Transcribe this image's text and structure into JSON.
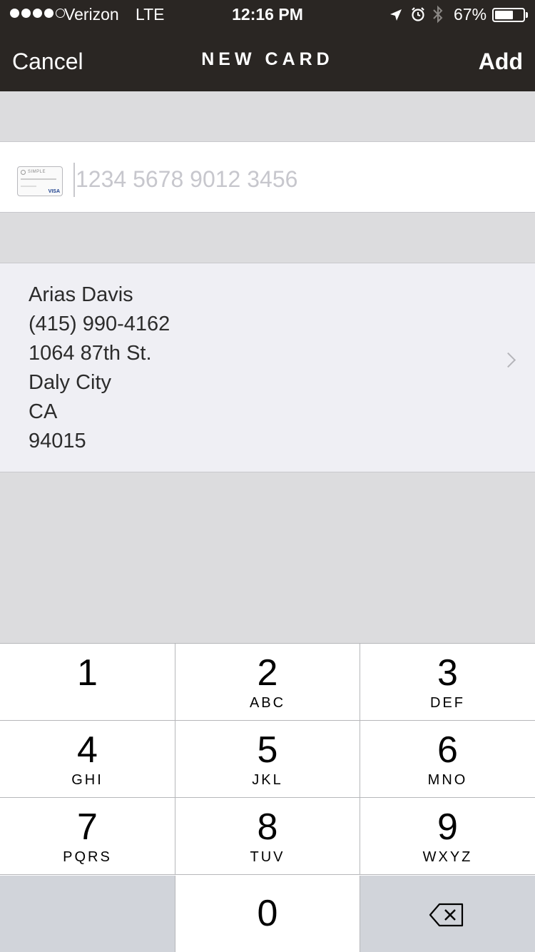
{
  "status_bar": {
    "carrier": "Verizon",
    "network": "LTE",
    "time": "12:16 PM",
    "battery": "67%",
    "battery_level": 0.67,
    "signal_bars": 4,
    "signal_total": 5,
    "icons": [
      "location-arrow-icon",
      "alarm-icon",
      "bluetooth-icon",
      "battery-icon"
    ]
  },
  "nav": {
    "cancel_label": "Cancel",
    "title": "NEW CARD",
    "add_label": "Add"
  },
  "card_field": {
    "placeholder": "1234 5678 9012 3456",
    "value": ""
  },
  "card_icon": {
    "brand": "SIMPLE",
    "network": "VISA"
  },
  "address": {
    "lines": [
      "Arias Davis",
      "(415) 990-4162",
      "1064 87th St.",
      "Daly City",
      "CA",
      "94015"
    ]
  },
  "keypad": {
    "keys": [
      {
        "digit": "1",
        "letters": ""
      },
      {
        "digit": "2",
        "letters": "ABC"
      },
      {
        "digit": "3",
        "letters": "DEF"
      },
      {
        "digit": "4",
        "letters": "GHI"
      },
      {
        "digit": "5",
        "letters": "JKL"
      },
      {
        "digit": "6",
        "letters": "MNO"
      },
      {
        "digit": "7",
        "letters": "PQRS"
      },
      {
        "digit": "8",
        "letters": "TUV"
      },
      {
        "digit": "9",
        "letters": "WXYZ"
      },
      {
        "digit": "0",
        "letters": ""
      }
    ]
  },
  "colors": {
    "header_bg": "#2a2623",
    "page_bg": "#dcdcde",
    "address_bg": "#efeff4",
    "keypad_dark": "#d1d4da"
  }
}
